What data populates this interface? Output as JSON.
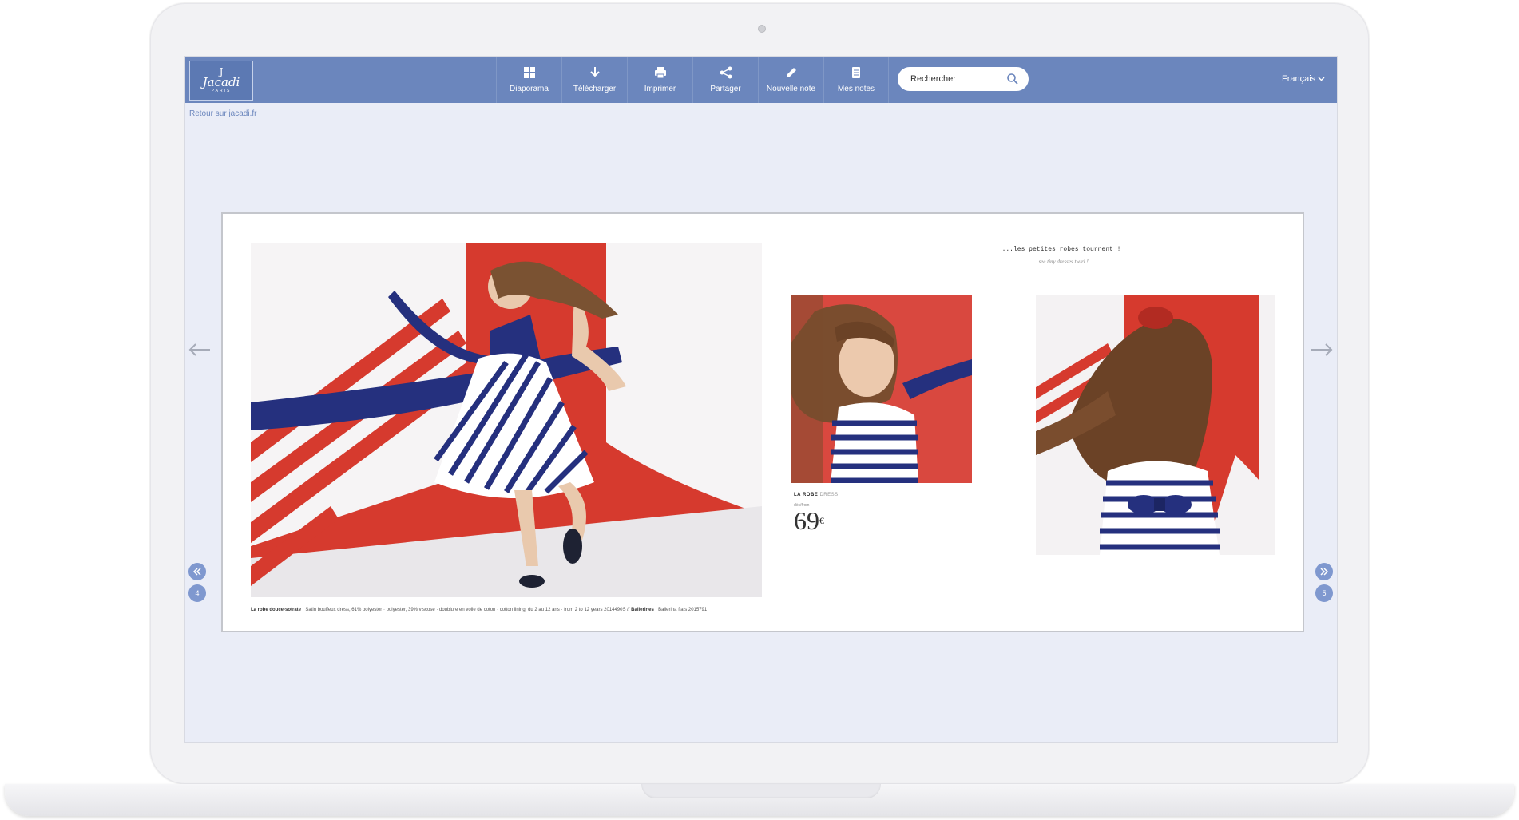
{
  "brand": {
    "logo_mark": "J",
    "name": "Jacadi",
    "subline": "PARIS"
  },
  "toolbar": {
    "tools": [
      {
        "label": "Diaporama",
        "icon": "grid-icon"
      },
      {
        "label": "Télécharger",
        "icon": "download-icon"
      },
      {
        "label": "Imprimer",
        "icon": "print-icon"
      },
      {
        "label": "Partager",
        "icon": "share-icon"
      },
      {
        "label": "Nouvelle note",
        "icon": "pencil-icon"
      },
      {
        "label": "Mes notes",
        "icon": "notes-icon"
      }
    ],
    "search": {
      "placeholder": "Rechercher"
    },
    "language": "Français"
  },
  "back_link": "Retour sur jacadi.fr",
  "spread": {
    "heading": "...les petites robes tournent !",
    "subheading": "...see tiny dresses twirl !",
    "caption_bold": "La robe douce-sotrate",
    "caption_text": " · Satin bouffeux dress, 61% polyester · polyester, 39% viscose · doublure en voile de coton · cotton lining, du 2 au 12 ans · from 2 to 12 years 2014490S // ",
    "caption_bold2": "Ballerines",
    "caption_text2": " · Ballerina flats 2015791",
    "product": {
      "name": "LA ROBE",
      "name_en": "DRESS",
      "sub": "dès/from",
      "price": "69",
      "currency": "€"
    }
  },
  "pagination": {
    "prev_page": "4",
    "next_page": "5"
  },
  "colors": {
    "toolbar": "#6b86bd",
    "background": "#eaedf7",
    "accent_red": "#d63a2e",
    "stripe_blue": "#25307e"
  }
}
